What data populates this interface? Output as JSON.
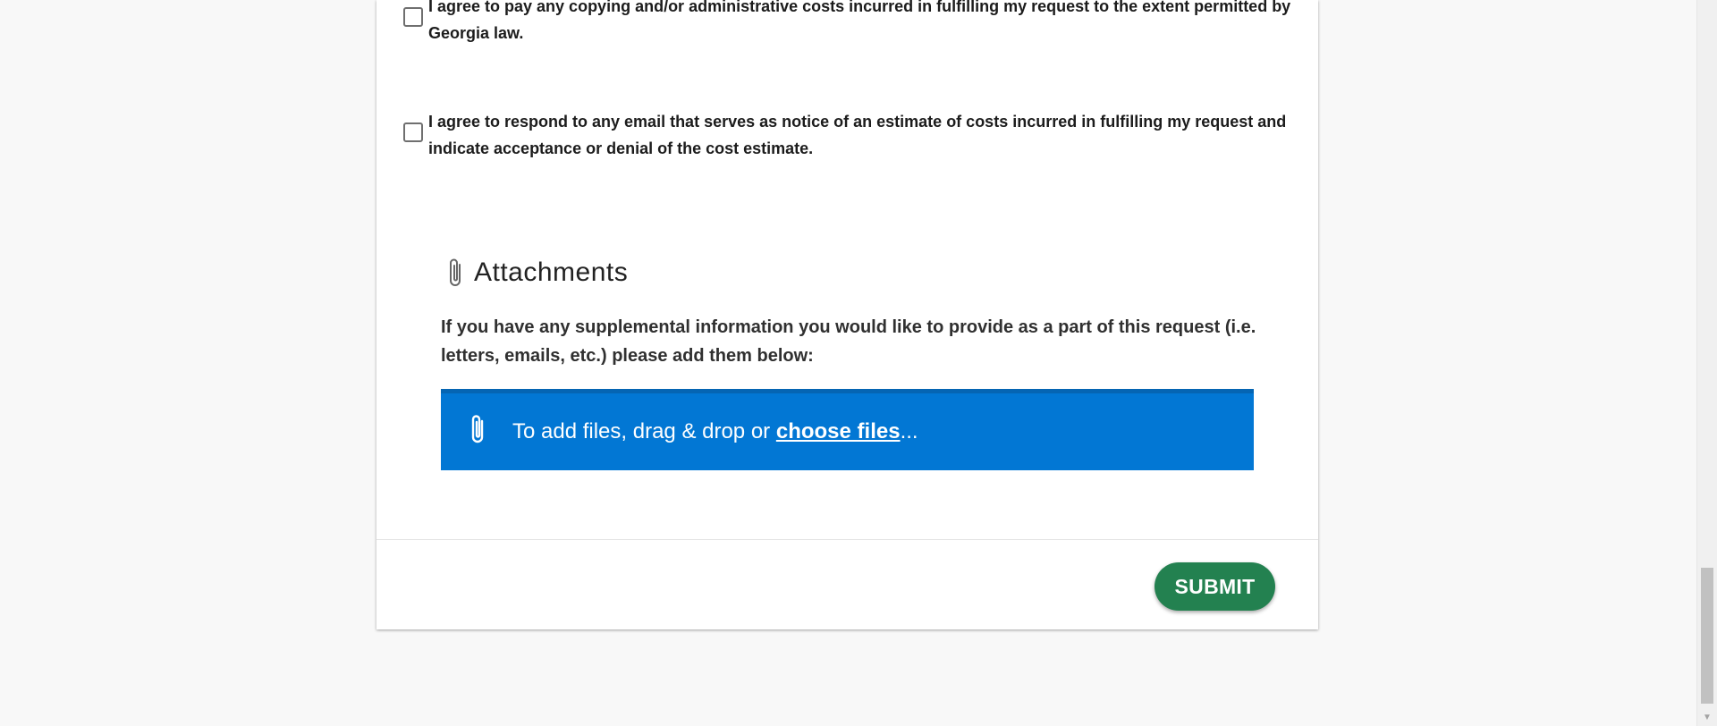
{
  "consents": [
    {
      "text": "I agree to pay any copying and/or administrative costs incurred in fulfilling my request to the extent permitted by Georgia law."
    },
    {
      "text": "I agree to respond to any email that serves as notice of an estimate of costs incurred in fulfilling my request and indicate acceptance or denial of the cost estimate."
    }
  ],
  "attachments": {
    "icon": "paperclip-icon",
    "title": "Attachments",
    "description": "If you have any supplemental information you would like to provide as a part of this request (i.e. letters, emails, etc.) please add them below:",
    "dropzone": {
      "icon": "paperclip-icon",
      "prefix": "To add files, drag & drop or ",
      "link": "choose files",
      "suffix": "..."
    }
  },
  "submit_label": "SUBMIT",
  "colors": {
    "dropzone": "#0277d4",
    "submit": "#238150",
    "background": "#f8f8f8"
  },
  "scrollbar": {
    "arrow": "▼"
  }
}
